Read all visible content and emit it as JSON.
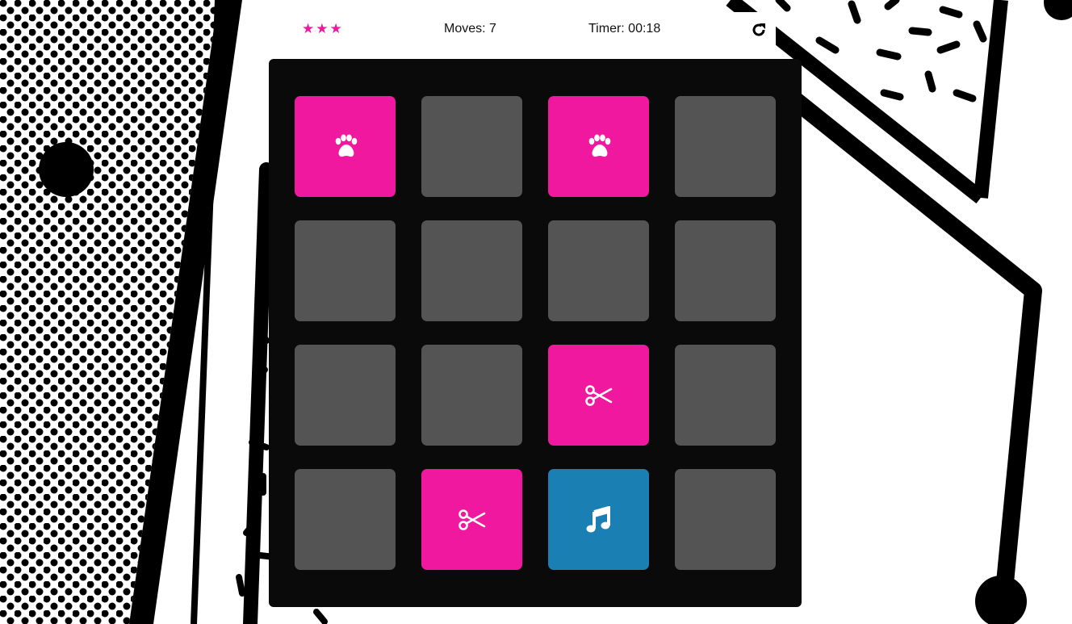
{
  "score_panel": {
    "stars": [
      "★",
      "★",
      "★"
    ],
    "moves_text": "Moves: 7",
    "timer_text": "Timer: 00:18",
    "restart_icon": "redo-icon"
  },
  "colors": {
    "matched": "#f0189f",
    "open": "#1a80b3",
    "hidden": "#545454",
    "deck": "#0a0a0a",
    "star": "#f0189f"
  },
  "deck": {
    "cards": [
      {
        "state": "match",
        "icon": "paw-icon"
      },
      {
        "state": "hidden",
        "icon": ""
      },
      {
        "state": "match",
        "icon": "paw-icon"
      },
      {
        "state": "hidden",
        "icon": ""
      },
      {
        "state": "hidden",
        "icon": ""
      },
      {
        "state": "hidden",
        "icon": ""
      },
      {
        "state": "hidden",
        "icon": ""
      },
      {
        "state": "hidden",
        "icon": ""
      },
      {
        "state": "hidden",
        "icon": ""
      },
      {
        "state": "hidden",
        "icon": ""
      },
      {
        "state": "match",
        "icon": "scissors-icon"
      },
      {
        "state": "hidden",
        "icon": ""
      },
      {
        "state": "hidden",
        "icon": ""
      },
      {
        "state": "match",
        "icon": "scissors-icon"
      },
      {
        "state": "open",
        "icon": "music-note-icon"
      },
      {
        "state": "hidden",
        "icon": ""
      }
    ]
  }
}
